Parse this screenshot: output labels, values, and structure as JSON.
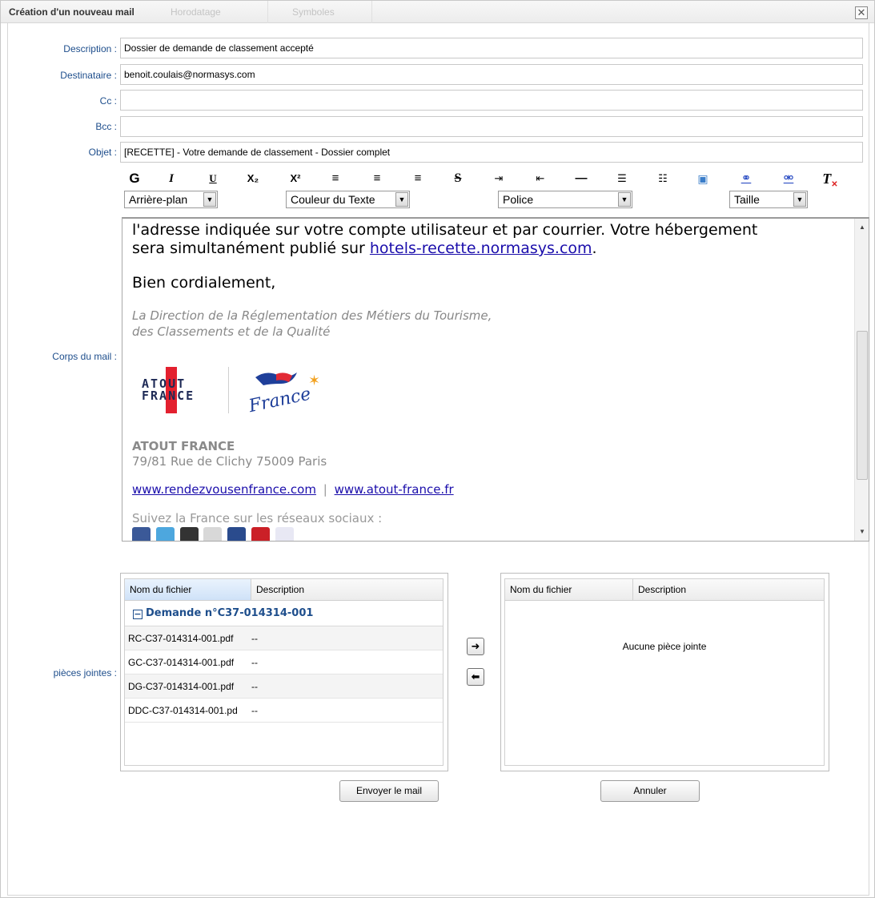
{
  "window": {
    "tabs": [
      "Création d'un nouveau mail",
      "Horodatage",
      "Symboles"
    ],
    "close_glyph": "✕"
  },
  "form": {
    "description_label": "Description :",
    "description_value": "Dossier de demande de classement accepté",
    "destinataire_label": "Destinataire :",
    "destinataire_value": "benoit.coulais@normasys.com",
    "cc_label": "Cc :",
    "cc_value": "",
    "bcc_label": "Bcc :",
    "bcc_value": "",
    "objet_label": "Objet :",
    "objet_value": "[RECETTE] - Votre demande de classement - Dossier complet",
    "corps_label": "Corps du mail :",
    "pj_label": "pièces jointes :"
  },
  "toolbar": {
    "buttons": [
      {
        "name": "bold-button",
        "glyph": "G"
      },
      {
        "name": "italic-button",
        "glyph": "I"
      },
      {
        "name": "underline-button",
        "glyph": "U"
      },
      {
        "name": "subscript-button",
        "glyph": "X₂"
      },
      {
        "name": "superscript-button",
        "glyph": "X²"
      },
      {
        "name": "align-left-button",
        "glyph": "≡"
      },
      {
        "name": "align-center-button",
        "glyph": "≡"
      },
      {
        "name": "align-right-button",
        "glyph": "≡"
      },
      {
        "name": "strikethrough-button",
        "glyph": "S"
      },
      {
        "name": "indent-button",
        "glyph": "⇥"
      },
      {
        "name": "outdent-button",
        "glyph": "⇤"
      },
      {
        "name": "horizontal-rule-button",
        "glyph": "—"
      },
      {
        "name": "ordered-list-button",
        "glyph": "☰"
      },
      {
        "name": "unordered-list-button",
        "glyph": "☷"
      },
      {
        "name": "insert-image-button",
        "glyph": "▣"
      },
      {
        "name": "insert-link-button",
        "glyph": "⚭"
      },
      {
        "name": "remove-link-button",
        "glyph": "⚮"
      },
      {
        "name": "clear-format-button",
        "glyph": "T"
      }
    ],
    "background_select": "Arrière-plan",
    "text_color_select": "Couleur du Texte",
    "font_select": "Police",
    "size_select": "Taille"
  },
  "editor": {
    "line1": "l'adresse indiquée sur votre compte utilisateur et par courrier. Votre hébergement",
    "line2_prefix": "sera simultanément publié sur ",
    "line2_link": "hotels-recette.normasys.com",
    "line2_suffix": ".",
    "greeting": "Bien cordialement,",
    "sign1": "La Direction de la Réglementation des Métiers du Tourisme,",
    "sign2": "des Classements et de la Qualité",
    "logo_atout_line1": "ATOUT",
    "logo_atout_line2": "FRANCE",
    "logo_france": "France",
    "company": "ATOUT FRANCE",
    "address": "79/81 Rue de Clichy 75009 Paris",
    "link1": "www.rendezvousenfrance.com",
    "separator": "|",
    "link2": "www.atout-france.fr",
    "social_text": "Suivez la France sur les réseaux sociaux :",
    "social_icons": [
      "facebook-icon",
      "twitter-icon",
      "google-plus-icon",
      "youtube-icon",
      "dailymotion-icon",
      "pinterest-icon",
      "flickr-icon"
    ]
  },
  "left_grid": {
    "col1": "Nom du fichier",
    "col2": "Description",
    "group": "Demande n°C37-014314-001",
    "group_toggle": "−",
    "rows": [
      {
        "file": "RC-C37-014314-001.pdf",
        "desc": "--"
      },
      {
        "file": "GC-C37-014314-001.pdf",
        "desc": "--"
      },
      {
        "file": "DG-C37-014314-001.pdf",
        "desc": "--"
      },
      {
        "file": "DDC-C37-014314-001.pd",
        "desc": "--"
      }
    ]
  },
  "right_grid": {
    "col1": "Nom du fichier",
    "col2": "Description",
    "empty": "Aucune pièce jointe"
  },
  "buttons": {
    "move_right": "➜",
    "move_left": "⬅",
    "send": "Envoyer le mail",
    "cancel": "Annuler"
  }
}
